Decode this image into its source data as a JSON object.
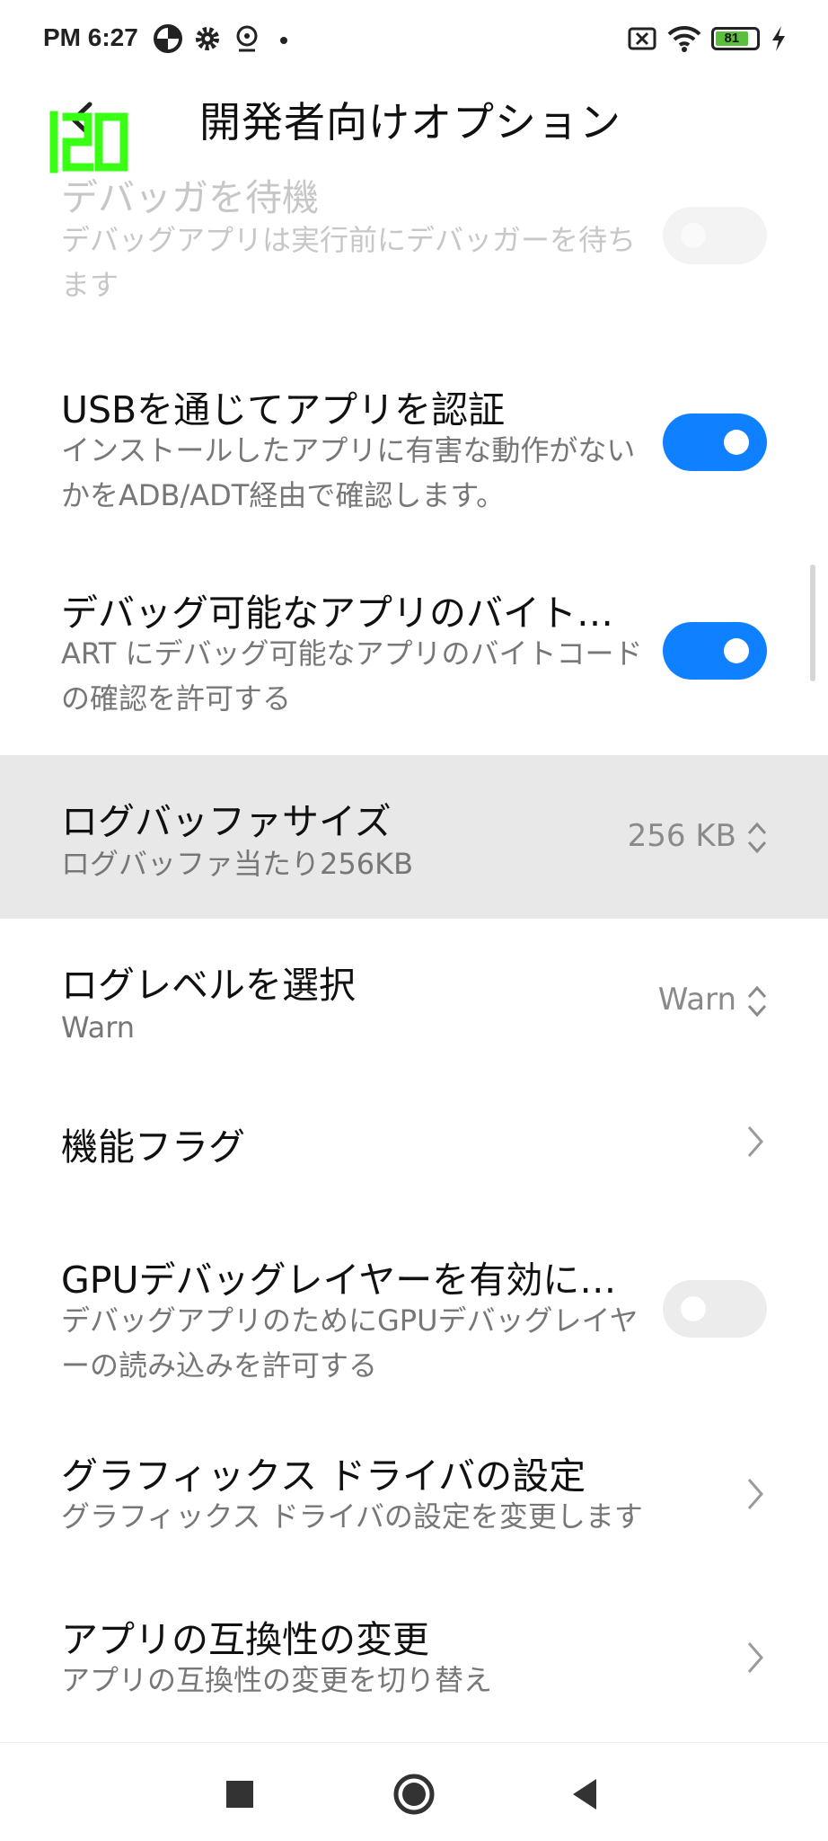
{
  "status_bar": {
    "time": "PM 6:27",
    "battery": "81",
    "icons": [
      "data-saver-icon",
      "settings-icon",
      "hotspot-icon",
      "dot-icon",
      "no-sim-icon",
      "wifi-icon",
      "battery-icon",
      "charging-icon"
    ]
  },
  "header": {
    "title": "開発者向けオプション",
    "fps_overlay": "120"
  },
  "rows": [
    {
      "title": "デバッガを待機",
      "subtitle": "デバッグアプリは実行前にデバッガーを待ちます",
      "control": "toggle",
      "state": "off",
      "enabled": false
    },
    {
      "title": "USBを通じてアプリを認証",
      "subtitle": "インストールしたアプリに有害な動作がないかをADB/ADT経由で確認します。",
      "control": "toggle",
      "state": "on"
    },
    {
      "title": "デバッグ可能なアプリのバイト…",
      "subtitle": "ART にデバッグ可能なアプリのバイトコードの確認を許可する",
      "control": "toggle",
      "state": "on"
    },
    {
      "title": "ログバッファサイズ",
      "subtitle": "ログバッファ当たり256KB",
      "control": "select",
      "value": "256 KB"
    },
    {
      "title": "ログレベルを選択",
      "subtitle": "Warn",
      "control": "select",
      "value": "Warn"
    },
    {
      "title": "機能フラグ",
      "control": "chevron"
    },
    {
      "title": "GPUデバッグレイヤーを有効に…",
      "subtitle": "デバッグアプリのためにGPUデバッグレイヤーの読み込みを許可する",
      "control": "toggle",
      "state": "off"
    },
    {
      "title": "グラフィックス ドライバの設定",
      "subtitle": "グラフィックス ドライバの設定を変更します",
      "control": "chevron"
    },
    {
      "title": "アプリの互換性の変更",
      "subtitle": "アプリの互換性の変更を切り替え",
      "control": "chevron"
    }
  ],
  "colors": {
    "accent": "#0f80ff",
    "highlight_row": "#e8e8e8",
    "fps_overlay": "#39ff14"
  }
}
